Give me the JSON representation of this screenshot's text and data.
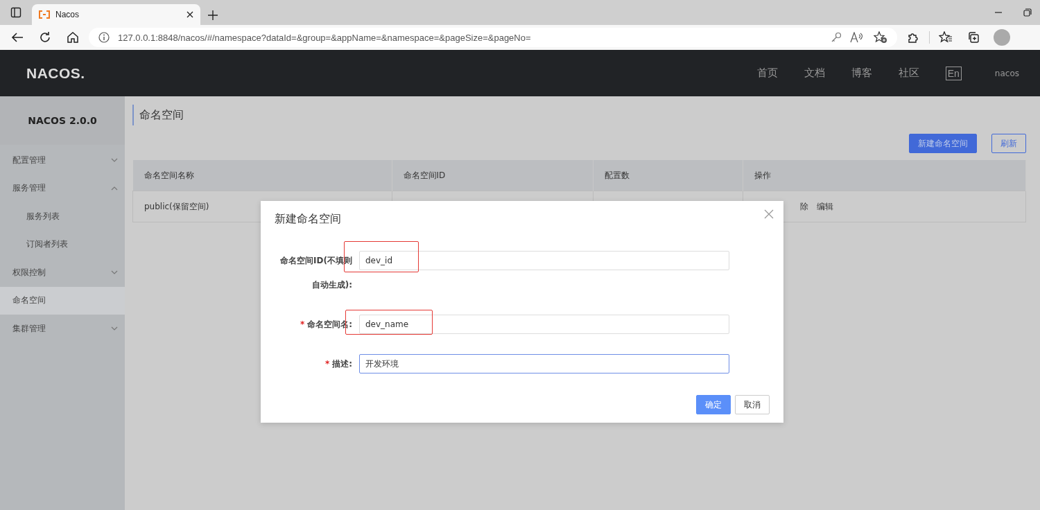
{
  "browser": {
    "tab": {
      "title": "Nacos"
    },
    "url": "127.0.0.1:8848/nacos/#/namespace?dataId=&group=&appName=&namespace=&pageSize=&pageNo="
  },
  "header": {
    "logo": "NACOS.",
    "nav": [
      "首页",
      "文档",
      "博客",
      "社区"
    ],
    "lang": "En",
    "user": "nacos"
  },
  "sidebar": {
    "title": "NACOS 2.0.0",
    "items": [
      {
        "label": "配置管理",
        "expanded": false,
        "selected": false
      },
      {
        "label": "服务管理",
        "expanded": true,
        "selected": false,
        "children": [
          {
            "label": "服务列表",
            "selected": false
          },
          {
            "label": "订阅者列表",
            "selected": false
          }
        ]
      },
      {
        "label": "权限控制",
        "expanded": false,
        "selected": false
      },
      {
        "label": "命名空间",
        "selected": true
      },
      {
        "label": "集群管理",
        "expanded": false,
        "selected": false
      }
    ]
  },
  "page": {
    "title": "命名空间",
    "buttons": [
      {
        "label": "新建命名空间",
        "kind": "primary"
      },
      {
        "label": "刷新",
        "kind": "outline"
      }
    ]
  },
  "table": {
    "columns": [
      "命名空间名称",
      "命名空间ID",
      "配置数",
      "操作"
    ],
    "rows": [
      {
        "name": "public(保留空间)",
        "actions": [
          "除",
          "编辑"
        ]
      }
    ]
  },
  "dialog": {
    "title": "新建命名空间",
    "fields": [
      {
        "label": "命名空间ID(不填则自动生成):",
        "value": "dev_id",
        "focused": false,
        "highlighted": true
      },
      {
        "marker": "*",
        "label": "命名空间名:",
        "value": "dev_name",
        "focused": false,
        "highlighted": true
      },
      {
        "marker": "*",
        "label": "描述:",
        "value": "开发环境",
        "focused": true,
        "highlighted": false
      }
    ],
    "buttons": [
      {
        "label": "确定",
        "kind": "primary"
      },
      {
        "label": "取消",
        "kind": "secondary"
      }
    ]
  }
}
